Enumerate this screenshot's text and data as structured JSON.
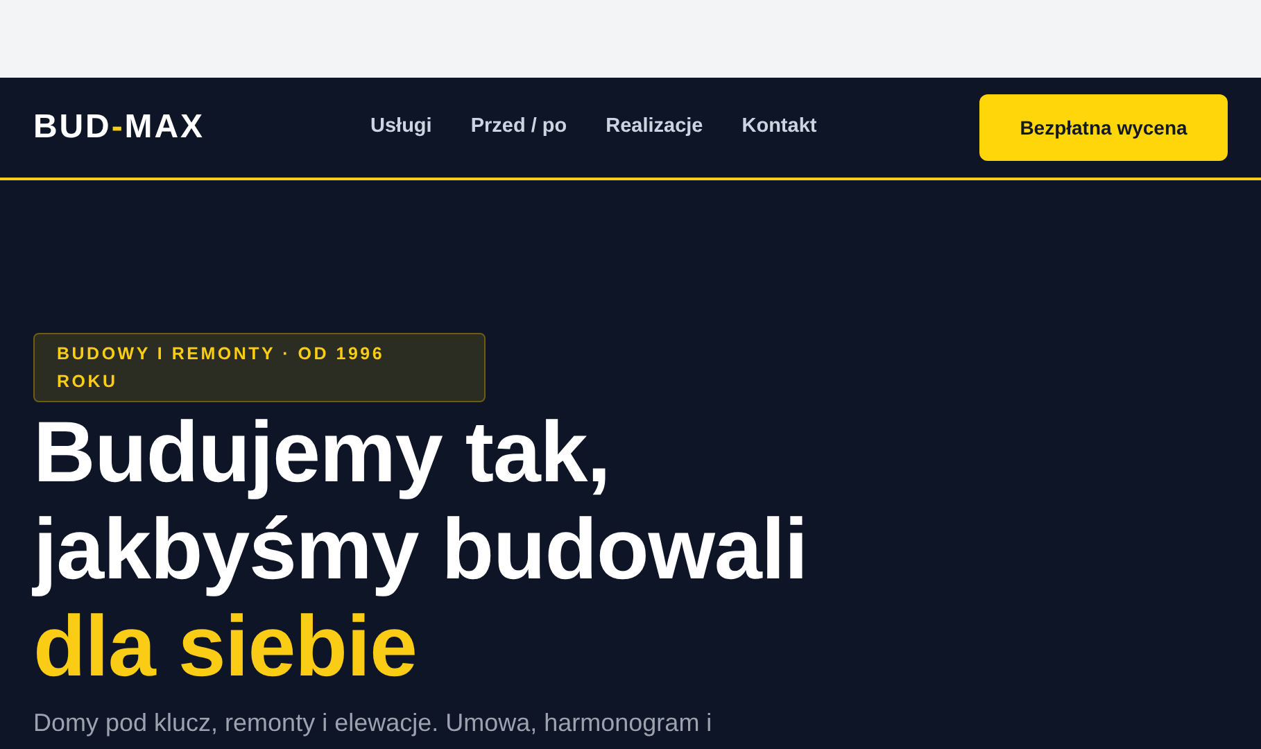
{
  "logo": {
    "parts": [
      {
        "text": "BUD",
        "accent": false
      },
      {
        "text": "-",
        "accent": true
      },
      {
        "text": "MAX",
        "accent": false
      }
    ]
  },
  "nav": {
    "links": [
      "Usługi",
      "Przed / po",
      "Realizacje",
      "Kontakt"
    ],
    "cta": "Bezpłatna wycena"
  },
  "hero": {
    "badge": "BUDOWY I REMONTY · OD 1996 ROKU",
    "heading": [
      {
        "text": "Budujemy tak,",
        "accent": false
      },
      {
        "text": "jakbyśmy budowali",
        "accent": false
      },
      {
        "text": "dla siebie",
        "accent": true
      }
    ],
    "lead": "Domy pod klucz, remonty i elewacje. Umowa, harmonogram i"
  }
}
